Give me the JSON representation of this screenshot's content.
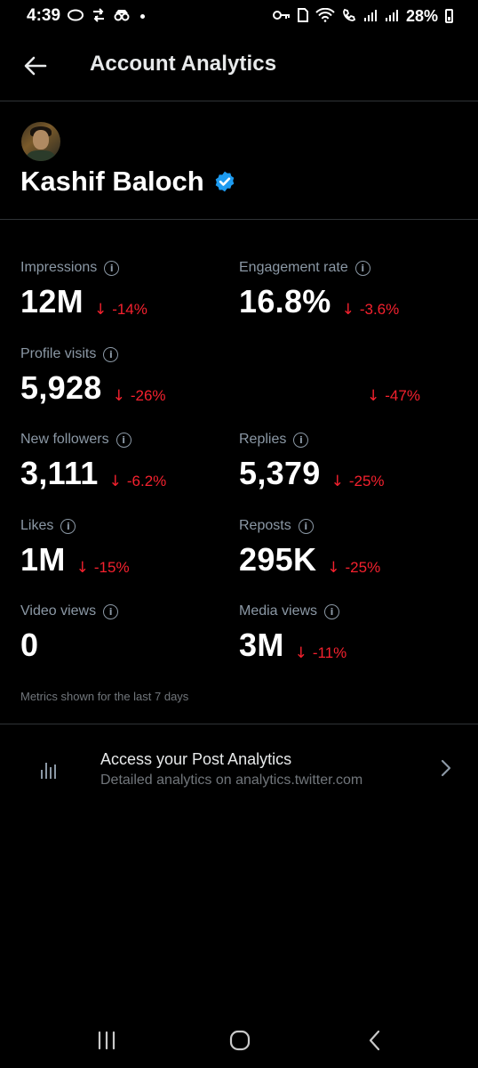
{
  "status_bar": {
    "time": "4:39",
    "battery": "28%",
    "left_icons": [
      "messages-icon",
      "repost-notification-icon",
      "incognito-icon"
    ],
    "right_icons": [
      "vpn-key-icon",
      "sim-icon",
      "wifi-icon",
      "volte-call-icon",
      "signal-icon",
      "signal-2-icon"
    ]
  },
  "header": {
    "title": "Account Analytics"
  },
  "profile": {
    "name": "Kashif Baloch",
    "verified": true,
    "accent": "#1d9bf0"
  },
  "metrics": [
    {
      "label": "Impressions",
      "value": "12M",
      "change": "-14%"
    },
    {
      "label": "Engagement rate",
      "value": "16.8%",
      "change": "-3.6%"
    },
    {
      "label": "Profile visits",
      "value": "5,928",
      "change": "-26%"
    },
    {
      "label": "",
      "value": "",
      "change": "-47%"
    },
    {
      "label": "New followers",
      "value": "3,111",
      "change": "-6.2%"
    },
    {
      "label": "Replies",
      "value": "5,379",
      "change": "-25%"
    },
    {
      "label": "Likes",
      "value": "1M",
      "change": "-15%"
    },
    {
      "label": "Reposts",
      "value": "295K",
      "change": "-25%"
    },
    {
      "label": "Video views",
      "value": "0",
      "change": ""
    },
    {
      "label": "Media views",
      "value": "3M",
      "change": "-11%"
    }
  ],
  "metrics_note": "Metrics shown for the last 7 days",
  "post_analytics": {
    "title": "Access your Post Analytics",
    "subtitle": "Detailed analytics on analytics.twitter.com"
  },
  "colors": {
    "background": "#000000",
    "negative": "#f4212e",
    "muted": "#8b98a5",
    "verified": "#1d9bf0"
  }
}
